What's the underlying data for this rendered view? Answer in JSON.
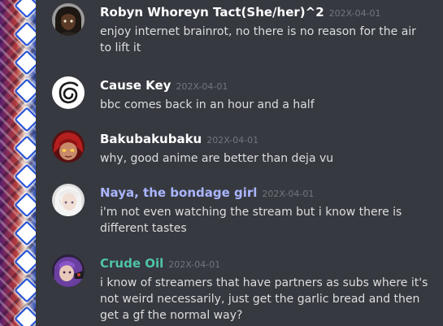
{
  "colors": {
    "background": "#36393f",
    "author_default": "#ffffff",
    "author_naya": "#aab5ff",
    "author_crude": "#4fc3a8",
    "timestamp": "#72767d",
    "message_text": "#dcddde"
  },
  "messages": [
    {
      "author": "Robyn Whoreyn Tact(She/her)^2",
      "timestamp": "202X-04-01",
      "content": "enjoy internet brainrot, no there is no reason for the air to lift it",
      "avatar_icon": "dark-haired-character-avatar"
    },
    {
      "author": "Cause Key",
      "timestamp": "202X-04-01",
      "content": "bbc comes back in an hour and a half",
      "avatar_icon": "swirl-logo-avatar"
    },
    {
      "author": "Bakubakubaku",
      "timestamp": "202X-04-01",
      "content": "why, good anime are better than deja vu",
      "avatar_icon": "red-haired-character-avatar"
    },
    {
      "author": "Naya, the bondage girl",
      "timestamp": "202X-04-01",
      "content": "i'm not even watching the stream but i know there is different tastes",
      "avatar_icon": "white-haired-character-avatar"
    },
    {
      "author": "Crude Oil",
      "timestamp": "202X-04-01",
      "content": "i know of streamers that have partners as subs where it's not weird necessarily, just get the garlic bread and then get a gf the normal way?",
      "avatar_icon": "purple-character-avatar"
    }
  ]
}
